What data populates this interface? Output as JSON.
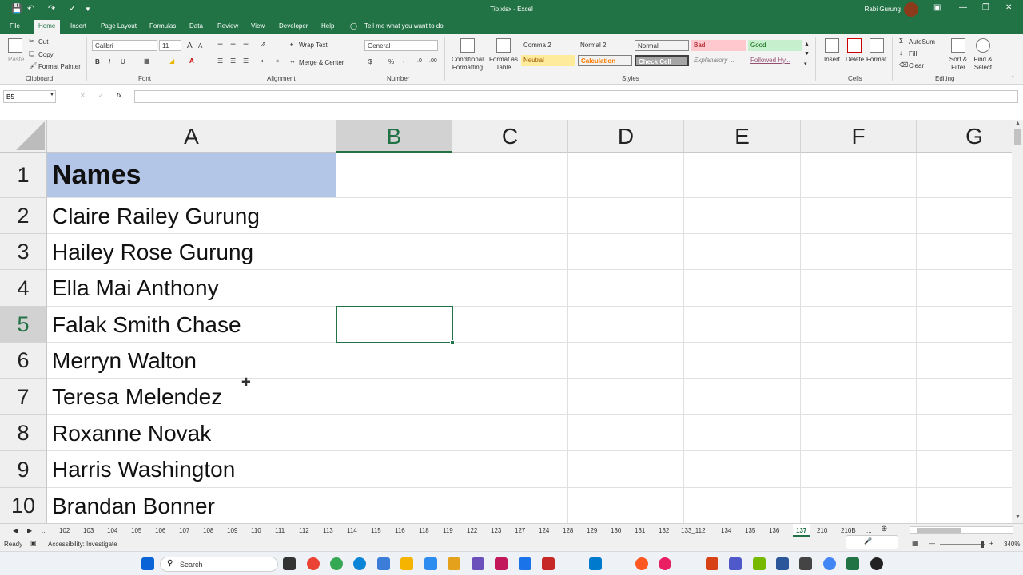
{
  "titlebar": {
    "document_title": "Tip.xlsx  -  Excel",
    "user_name": "Rabi Gurung",
    "accent_color": "#217346"
  },
  "tabs": [
    "File",
    "Home",
    "Insert",
    "Page Layout",
    "Formulas",
    "Data",
    "Review",
    "View",
    "Developer",
    "Help"
  ],
  "active_tab": "Home",
  "tell_me": "Tell me what you want to do",
  "ribbon": {
    "clipboard": {
      "cut": "Cut",
      "copy": "Copy",
      "format_painter": "Format Painter",
      "label": "Clipboard"
    },
    "font": {
      "name": "Calibri",
      "size": "11",
      "label": "Font",
      "bold": "B",
      "italic": "I",
      "underline": "U"
    },
    "alignment": {
      "wrap_text": "Wrap Text",
      "merge_center": "Merge & Center",
      "label": "Alignment"
    },
    "number": {
      "format": "General",
      "label": "Number",
      "currency": "$",
      "percent": "%",
      "comma": ","
    },
    "styles": {
      "conditional": "Conditional Formatting",
      "format_table": "Format as Table",
      "items": [
        {
          "text": "Comma 2",
          "bg": "#ffffff",
          "fg": "#333333"
        },
        {
          "text": "Normal 2",
          "bg": "#ffffff",
          "fg": "#333333"
        },
        {
          "text": "Normal",
          "bg": "#ffffff",
          "fg": "#333333"
        },
        {
          "text": "Bad",
          "bg": "#ffc7ce",
          "fg": "#9c0006"
        },
        {
          "text": "Good",
          "bg": "#c6efce",
          "fg": "#006100"
        },
        {
          "text": "Neutral",
          "bg": "#ffeb9c",
          "fg": "#9c5700"
        },
        {
          "text": "Calculation",
          "bg": "#f2f2f2",
          "fg": "#fa7d00"
        },
        {
          "text": "Check Cell",
          "bg": "#a5a5a5",
          "fg": "#ffffff"
        },
        {
          "text": "Explanatory ...",
          "bg": "#ffffff",
          "fg": "#7f7f7f"
        },
        {
          "text": "Followed Hy...",
          "bg": "#ffffff",
          "fg": "#954f72"
        }
      ],
      "label": "Styles"
    },
    "cells": {
      "insert": "Insert",
      "delete": "Delete",
      "format": "Format",
      "label": "Cells"
    },
    "editing": {
      "autosum": "AutoSum",
      "fill": "Fill",
      "clear": "Clear",
      "sort_filter": "Sort & Filter",
      "find_select": "Find & Select",
      "label": "Editing"
    }
  },
  "formula_bar": {
    "name_box": "B5",
    "fx": "fx",
    "value": ""
  },
  "columns": [
    "A",
    "B",
    "C",
    "D",
    "E",
    "F",
    "G"
  ],
  "selected_column": "B",
  "rows": [
    {
      "num": "1",
      "a": "Names"
    },
    {
      "num": "2",
      "a": "Claire Railey Gurung"
    },
    {
      "num": "3",
      "a": "Hailey Rose Gurung"
    },
    {
      "num": "4",
      "a": "Ella Mai Anthony"
    },
    {
      "num": "5",
      "a": "Falak Smith Chase"
    },
    {
      "num": "6",
      "a": "Merryn Walton"
    },
    {
      "num": "7",
      "a": "Teresa Melendez"
    },
    {
      "num": "8",
      "a": "Roxanne Novak"
    },
    {
      "num": "9",
      "a": "Harris Washington"
    },
    {
      "num": "10",
      "a": "Brandan Bonner"
    }
  ],
  "selected_row": "5",
  "header_fill": "#b4c6e7",
  "sheets": [
    "...",
    "102",
    "103",
    "104",
    "105",
    "106",
    "107",
    "108",
    "109",
    "110",
    "111",
    "112",
    "113",
    "114",
    "115",
    "116",
    "118",
    "119",
    "122",
    "123",
    "127",
    "124",
    "128",
    "129",
    "130",
    "131",
    "132",
    "133_112",
    "134",
    "135",
    "136",
    "137",
    "210",
    "210B",
    "..."
  ],
  "active_sheet": "137",
  "status": {
    "ready": "Ready",
    "accessibility": "Accessibility: Investigate",
    "zoom": "340%"
  },
  "taskbar": {
    "search": "Search"
  }
}
